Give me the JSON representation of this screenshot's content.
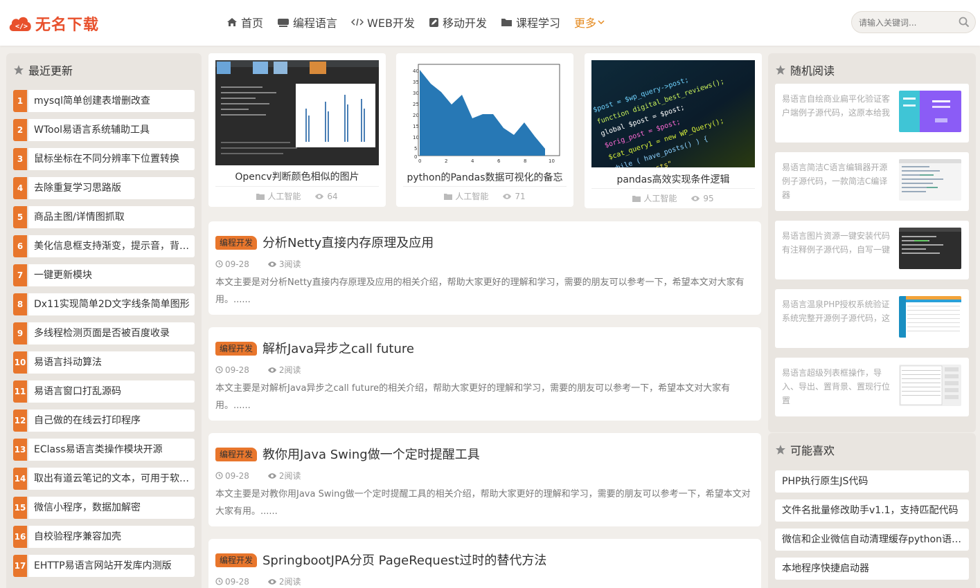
{
  "header": {
    "logo_text": "无名下载",
    "nav": [
      {
        "label": "首页"
      },
      {
        "label": "编程语言"
      },
      {
        "label": "WEB开发"
      },
      {
        "label": "移动开发"
      },
      {
        "label": "课程学习"
      },
      {
        "label": "更多"
      }
    ],
    "search_placeholder": "请输入关键词..."
  },
  "recent": {
    "title": "最近更新",
    "items": [
      {
        "num": "1",
        "label": "mysql简单创建表增删改查"
      },
      {
        "num": "2",
        "label": "WTool易语言系统辅助工具"
      },
      {
        "num": "3",
        "label": "鼠标坐标在不同分辨率下位置转换"
      },
      {
        "num": "4",
        "label": "去除重复学习思路版"
      },
      {
        "num": "5",
        "label": "商品主图/详情图抓取"
      },
      {
        "num": "6",
        "label": "美化信息框支持渐变，提示音，背景图"
      },
      {
        "num": "7",
        "label": "一键更新模块"
      },
      {
        "num": "8",
        "label": "Dx11实现简单2D文字线条简单图形"
      },
      {
        "num": "9",
        "label": "多线程检测页面是否被百度收录"
      },
      {
        "num": "10",
        "label": "易语言抖动算法"
      },
      {
        "num": "11",
        "label": "易语言窗口打乱源码"
      },
      {
        "num": "12",
        "label": "自己做的在线云打印程序"
      },
      {
        "num": "13",
        "label": "EClass易语言类操作模块开源"
      },
      {
        "num": "14",
        "label": "取出有道云笔记的文本，可用于软件公告"
      },
      {
        "num": "15",
        "label": "微信小程序，数据加解密"
      },
      {
        "num": "16",
        "label": "自校验程序兼容加壳"
      },
      {
        "num": "17",
        "label": "EHTTP易语言网站开发库内测版"
      }
    ]
  },
  "featured": [
    {
      "title": "Opencv判断颜色相似的图片",
      "category": "人工智能",
      "views": "64"
    },
    {
      "title": "python的Pandas数据可视化的备忘",
      "category": "人工智能",
      "views": "71"
    },
    {
      "title": "pandas高效实现条件逻辑",
      "category": "人工智能",
      "views": "95"
    }
  ],
  "articles": [
    {
      "badge": "编程开发",
      "title": "分析Netty直接内存原理及应用",
      "date": "09-28",
      "reads": "3阅读",
      "desc": "本文主要是对分析Netty直接内存原理及应用的相关介绍，帮助大家更好的理解和学习，需要的朋友可以参考一下，希望本文对大家有用。......"
    },
    {
      "badge": "编程开发",
      "title": "解析Java异步之call future",
      "date": "09-28",
      "reads": "2阅读",
      "desc": "本文主要是对解析Java异步之call future的相关介绍，帮助大家更好的理解和学习，需要的朋友可以参考一下，希望本文对大家有用。......"
    },
    {
      "badge": "编程开发",
      "title": "教你用Java Swing做一个定时提醒工具",
      "date": "09-28",
      "reads": "2阅读",
      "desc": "本文主要是对教你用Java Swing做一个定时提醒工具的相关介绍，帮助大家更好的理解和学习，需要的朋友可以参考一下，希望本文对大家有用。......"
    },
    {
      "badge": "编程开发",
      "title": "SpringbootJPA分页 PageRequest过时的替代方法",
      "date": "09-28",
      "reads": "2阅读",
      "desc": ""
    }
  ],
  "random": {
    "title": "随机阅读",
    "items": [
      {
        "text": "易语言自绘商业扁平化验证客户端例子源代码，这原本给我"
      },
      {
        "text": "易语言简洁C语言编辑器开源例子源代码，一款简洁C编译器"
      },
      {
        "text": "易语言图片资源一键安装代码有注释例子源代码，自写一键"
      },
      {
        "text": "易语言温泉PHP授权系统验证系统完整开源例子源代码，这"
      },
      {
        "text": "易语言超级列表框操作，导入、导出、置背景、置现行位置"
      }
    ]
  },
  "likes": {
    "title": "可能喜欢",
    "items": [
      {
        "label": "PHP执行原生JS代码"
      },
      {
        "label": "文件名批量修改助手v1.1，支持匹配代码"
      },
      {
        "label": "微信和企业微信自动清理缓存python语言实现"
      },
      {
        "label": "本地程序快捷启动器"
      }
    ]
  },
  "colors": {
    "accent": "#e8762c",
    "brand": "#e8502c",
    "more": "#e58a1f"
  }
}
